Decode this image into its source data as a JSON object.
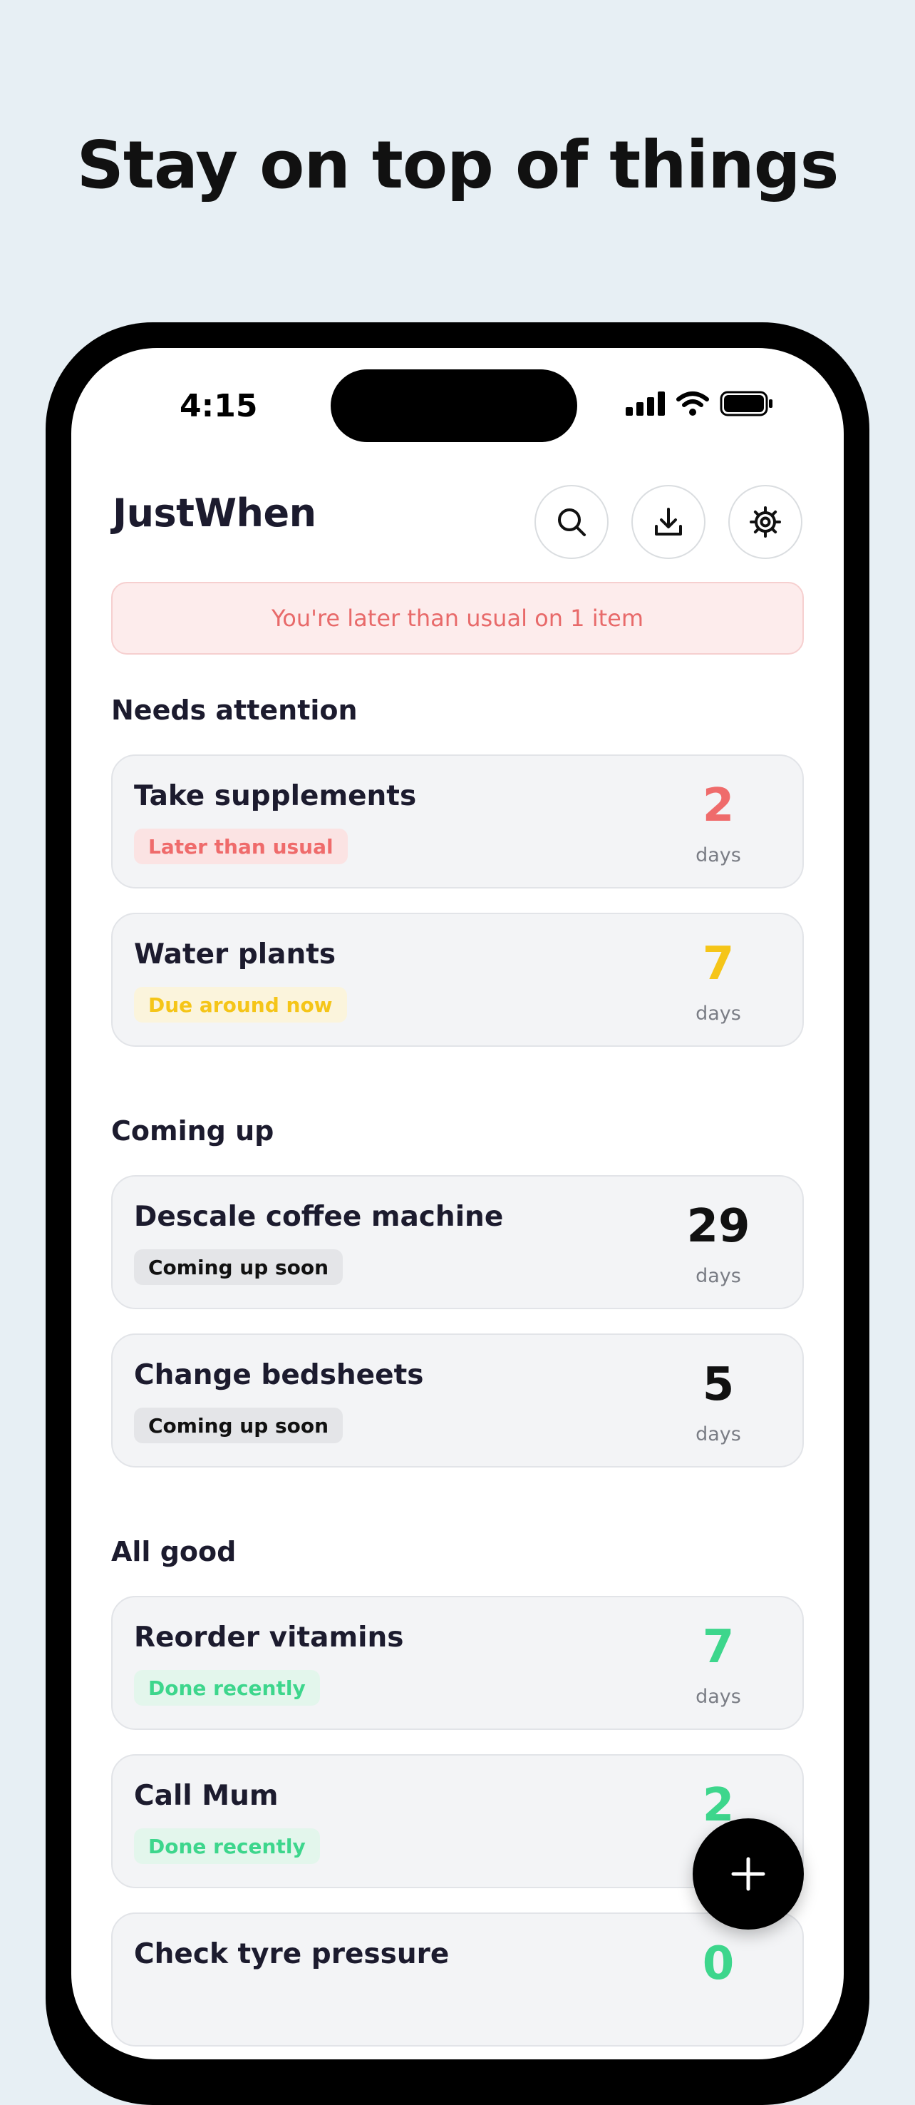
{
  "headline": "Stay on top of things",
  "status_bar": {
    "time": "4:15"
  },
  "app": {
    "title": "JustWhen"
  },
  "toolbar": {
    "search_icon": "search-icon",
    "download_icon": "download-icon",
    "settings_icon": "gear-icon"
  },
  "banner": {
    "text": "You're later than usual on 1 item"
  },
  "sections": {
    "needs_attention": "Needs attention",
    "coming_up": "Coming up",
    "all_good": "All good"
  },
  "items": [
    {
      "title": "Take supplements",
      "badge": "Later than usual",
      "count": "2",
      "unit": "days",
      "status_color": "#EF6B6B",
      "badge_bg": "#FBE3E3"
    },
    {
      "title": "Water plants",
      "badge": "Due around now",
      "count": "7",
      "unit": "days",
      "status_color": "#F5C518",
      "badge_bg": "#FBF4DC"
    },
    {
      "title": "Descale coffee machine",
      "badge": "Coming up soon",
      "count": "29",
      "unit": "days",
      "status_color": "#111111",
      "badge_bg": "#E4E5E8"
    },
    {
      "title": "Change bedsheets",
      "badge": "Coming up soon",
      "count": "5",
      "unit": "days",
      "status_color": "#111111",
      "badge_bg": "#E4E5E8"
    },
    {
      "title": "Reorder vitamins",
      "badge": "Done recently",
      "count": "7",
      "unit": "days",
      "status_color": "#3DD68C",
      "badge_bg": "#E3F6EC"
    },
    {
      "title": "Call Mum",
      "badge": "Done recently",
      "count": "2",
      "unit": "",
      "status_color": "#3DD68C",
      "badge_bg": "#E3F6EC"
    },
    {
      "title": "Check tyre pressure",
      "badge": "",
      "count": "0",
      "unit": "",
      "status_color": "#3DD68C",
      "badge_bg": "#E3F6EC"
    }
  ],
  "fab": {
    "icon": "plus-icon"
  }
}
